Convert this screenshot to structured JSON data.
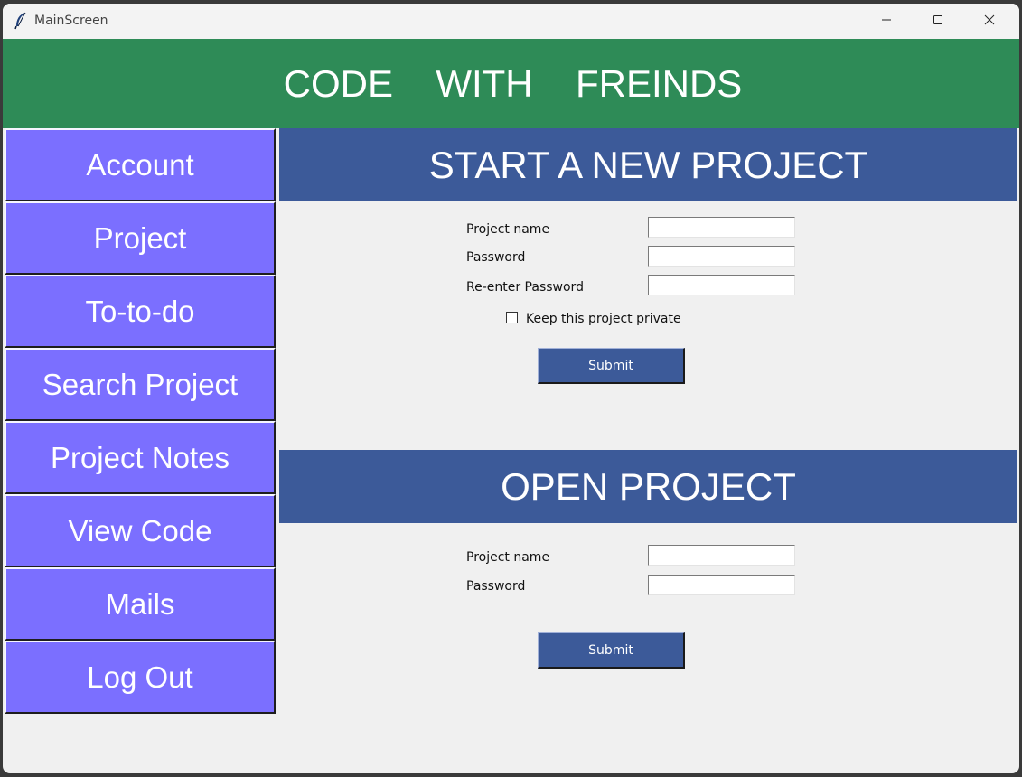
{
  "window": {
    "title": "MainScreen",
    "icon": "feather-icon"
  },
  "header": {
    "title": "CODE  WITH  FREINDS",
    "bg_color": "#2e8b57"
  },
  "sidebar": {
    "bg_color": "#7b6fff",
    "items": [
      {
        "label": "Account"
      },
      {
        "label": "Project"
      },
      {
        "label": "To-to-do"
      },
      {
        "label": "Search Project"
      },
      {
        "label": "Project Notes"
      },
      {
        "label": "View Code"
      },
      {
        "label": "Mails"
      },
      {
        "label": "Log Out"
      }
    ]
  },
  "new_project": {
    "title": "START A NEW PROJECT",
    "name_label": "Project name",
    "name_value": "",
    "password_label": "Password",
    "password_value": "",
    "reenter_label": "Re-enter Password",
    "reenter_value": "",
    "private_label": "Keep this project private",
    "private_checked": false,
    "submit_label": "Submit"
  },
  "open_project": {
    "title": "OPEN PROJECT",
    "name_label": "Project name",
    "name_value": "",
    "password_label": "Password",
    "password_value": "",
    "submit_label": "Submit"
  },
  "colors": {
    "section_header": "#3c5a99",
    "window_bg": "#f0f0f0"
  }
}
